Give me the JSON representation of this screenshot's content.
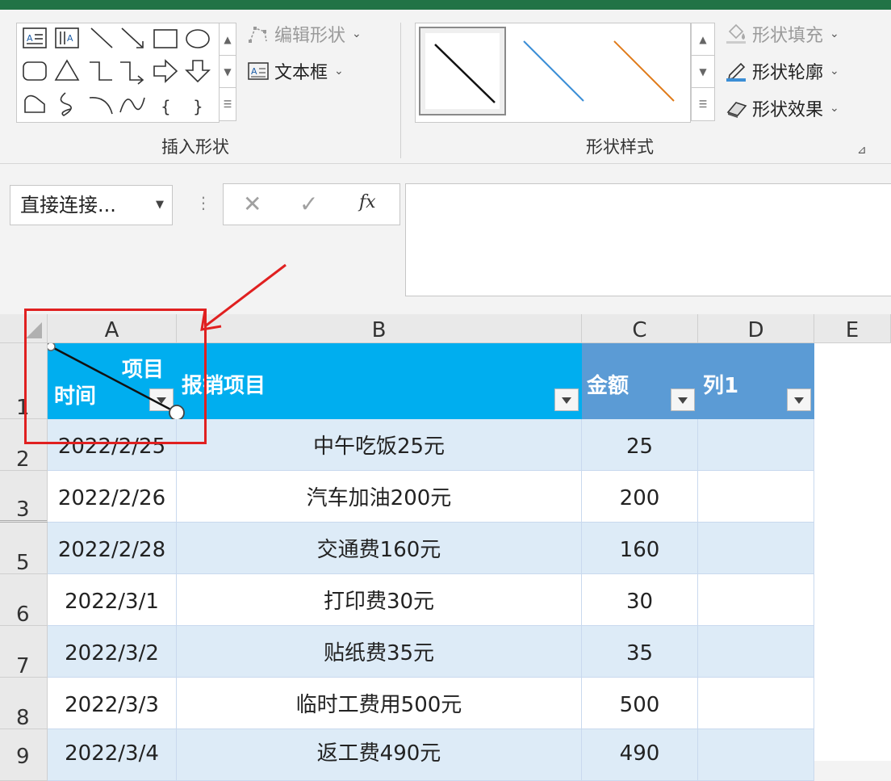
{
  "ribbon": {
    "edit_shape": "编辑形状",
    "text_box": "文本框",
    "insert_shapes_label": "插入形状",
    "shape_fill": "形状填充",
    "shape_outline": "形状轮廓",
    "shape_effects": "形状效果",
    "shape_styles_label": "形状样式",
    "style_colors": [
      "#111111",
      "#3b8ed6",
      "#e07b1a"
    ]
  },
  "formula": {
    "name_box": "直接连接...",
    "cancel": "✕",
    "enter": "✓",
    "fx": "fx",
    "value": ""
  },
  "sheet": {
    "columns": [
      "A",
      "B",
      "C",
      "D",
      "E"
    ],
    "row_numbers": [
      "1",
      "2",
      "3",
      "5",
      "6",
      "7",
      "8",
      "9"
    ],
    "header": {
      "a_top": "项目",
      "a_bottom": "时间",
      "b": "报销项目",
      "c": "金额",
      "d": "列1"
    },
    "rows": [
      {
        "date": "2022/2/25",
        "item": "中午吃饭25元",
        "amount": "25"
      },
      {
        "date": "2022/2/26",
        "item": "汽车加油200元",
        "amount": "200"
      },
      {
        "date": "2022/2/28",
        "item": "交通费160元",
        "amount": "160"
      },
      {
        "date": "2022/3/1",
        "item": "打印费30元",
        "amount": "30"
      },
      {
        "date": "2022/3/2",
        "item": "贴纸费35元",
        "amount": "35"
      },
      {
        "date": "2022/3/3",
        "item": "临时工费用500元",
        "amount": "500"
      },
      {
        "date": "2022/3/4",
        "item": "返工费490元",
        "amount": "490"
      }
    ],
    "colors": {
      "header_cyan": "#00aeef",
      "header_blue": "#5b9bd5",
      "band": "#ddebf7",
      "highlight": "#e02020"
    }
  }
}
